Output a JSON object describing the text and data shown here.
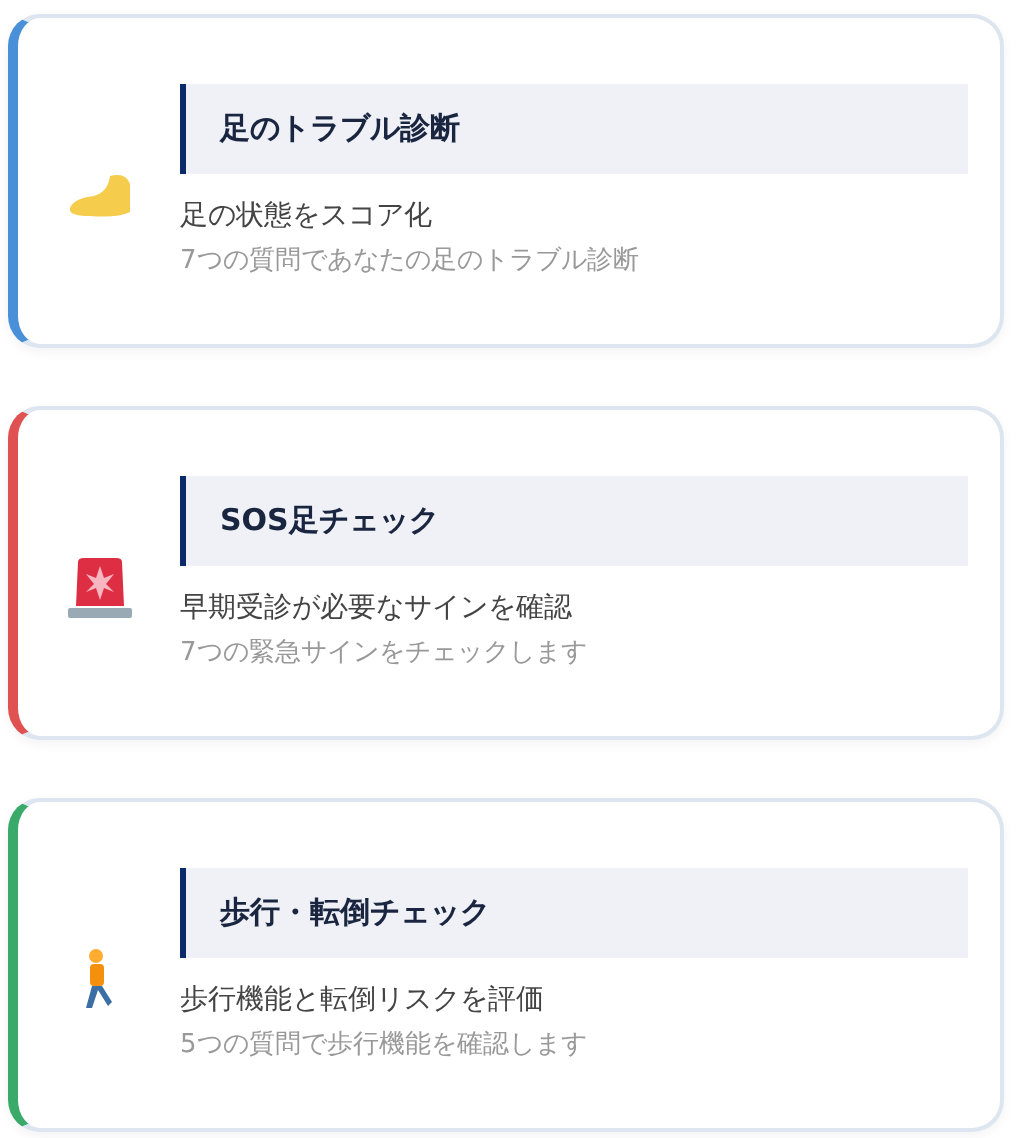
{
  "cards": [
    {
      "kind": "foot",
      "color": "#4a90d9",
      "title": "足のトラブル診断",
      "subtitle": "足の状態をスコア化",
      "description": "7つの質問であなたの足のトラブル診断"
    },
    {
      "kind": "siren",
      "color": "#e05252",
      "title": "SOS足チェック",
      "subtitle": "早期受診が必要なサインを確認",
      "description": "7つの緊急サインをチェックします"
    },
    {
      "kind": "walker",
      "color": "#3aaa6a",
      "title": "歩行・転倒チェック",
      "subtitle": "歩行機能と転倒リスクを評価",
      "description": "5つの質問で歩行機能を確認します"
    }
  ]
}
